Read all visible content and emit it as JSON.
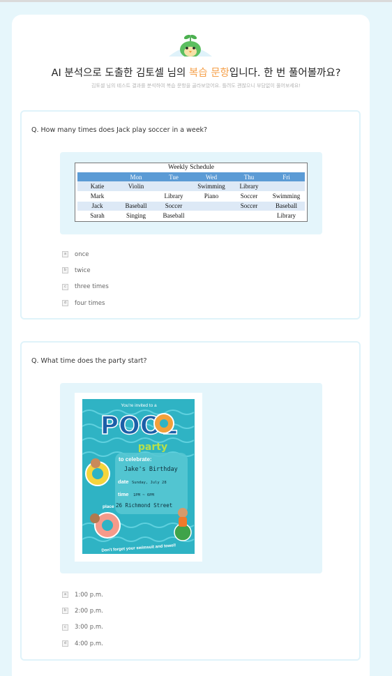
{
  "header": {
    "title_before": "AI 분석으로 도출한 김토셀 님의 ",
    "title_highlight": "복습 문항",
    "title_after": "입니다. 한 번 풀어볼까요?",
    "subtitle": "김토셀 님의 테스트 결과를 분석하여 복습 문항을 골라보았어요. 틀려도 괜찮으니 부담없이 풀어보세요!"
  },
  "colors": {
    "page_bg": "#e6f6fb",
    "accent": "#f5a04a",
    "figure_bg": "#e4f5fb",
    "table_header": "#5b9bd5"
  },
  "questions": [
    {
      "prompt": "Q. How many times does Jack play soccer in a week?",
      "figure": {
        "title": "Weekly Schedule",
        "columns": [
          "",
          "Mon",
          "Tue",
          "Wed",
          "Thu",
          "Fri"
        ],
        "rows": [
          [
            "Katie",
            "Violin",
            "",
            "Swimming",
            "Library",
            ""
          ],
          [
            "Mark",
            "",
            "Library",
            "Piano",
            "Soccer",
            "Swimming"
          ],
          [
            "Jack",
            "Baseball",
            "Soccer",
            "",
            "Soccer",
            "Baseball"
          ],
          [
            "Sarah",
            "Singing",
            "Baseball",
            "",
            "",
            "Library"
          ]
        ]
      },
      "options": [
        {
          "badge": "a",
          "label": "once"
        },
        {
          "badge": "b",
          "label": "twice"
        },
        {
          "badge": "c",
          "label": "three times"
        },
        {
          "badge": "d",
          "label": "four times"
        }
      ]
    },
    {
      "prompt": "Q. What time does the party start?",
      "figure": {
        "invited": "You're invited to a",
        "pool": "POOL",
        "party": "party",
        "celebrate_label": "to celebrate:",
        "celebrate_value": "Jake's Birthday",
        "date_label": "date",
        "date_value": "Sunday, July 28",
        "time_label": "time",
        "time_value": "1PM ~ 6PM",
        "place_label": "place",
        "place_value": "26 Richmond Street",
        "footer": "Don't forget your swimsuit and towel!"
      },
      "options": [
        {
          "badge": "a",
          "label": "1:00 p.m."
        },
        {
          "badge": "b",
          "label": "2:00 p.m."
        },
        {
          "badge": "c",
          "label": "3:00 p.m."
        },
        {
          "badge": "d",
          "label": "4:00 p.m."
        }
      ]
    }
  ]
}
